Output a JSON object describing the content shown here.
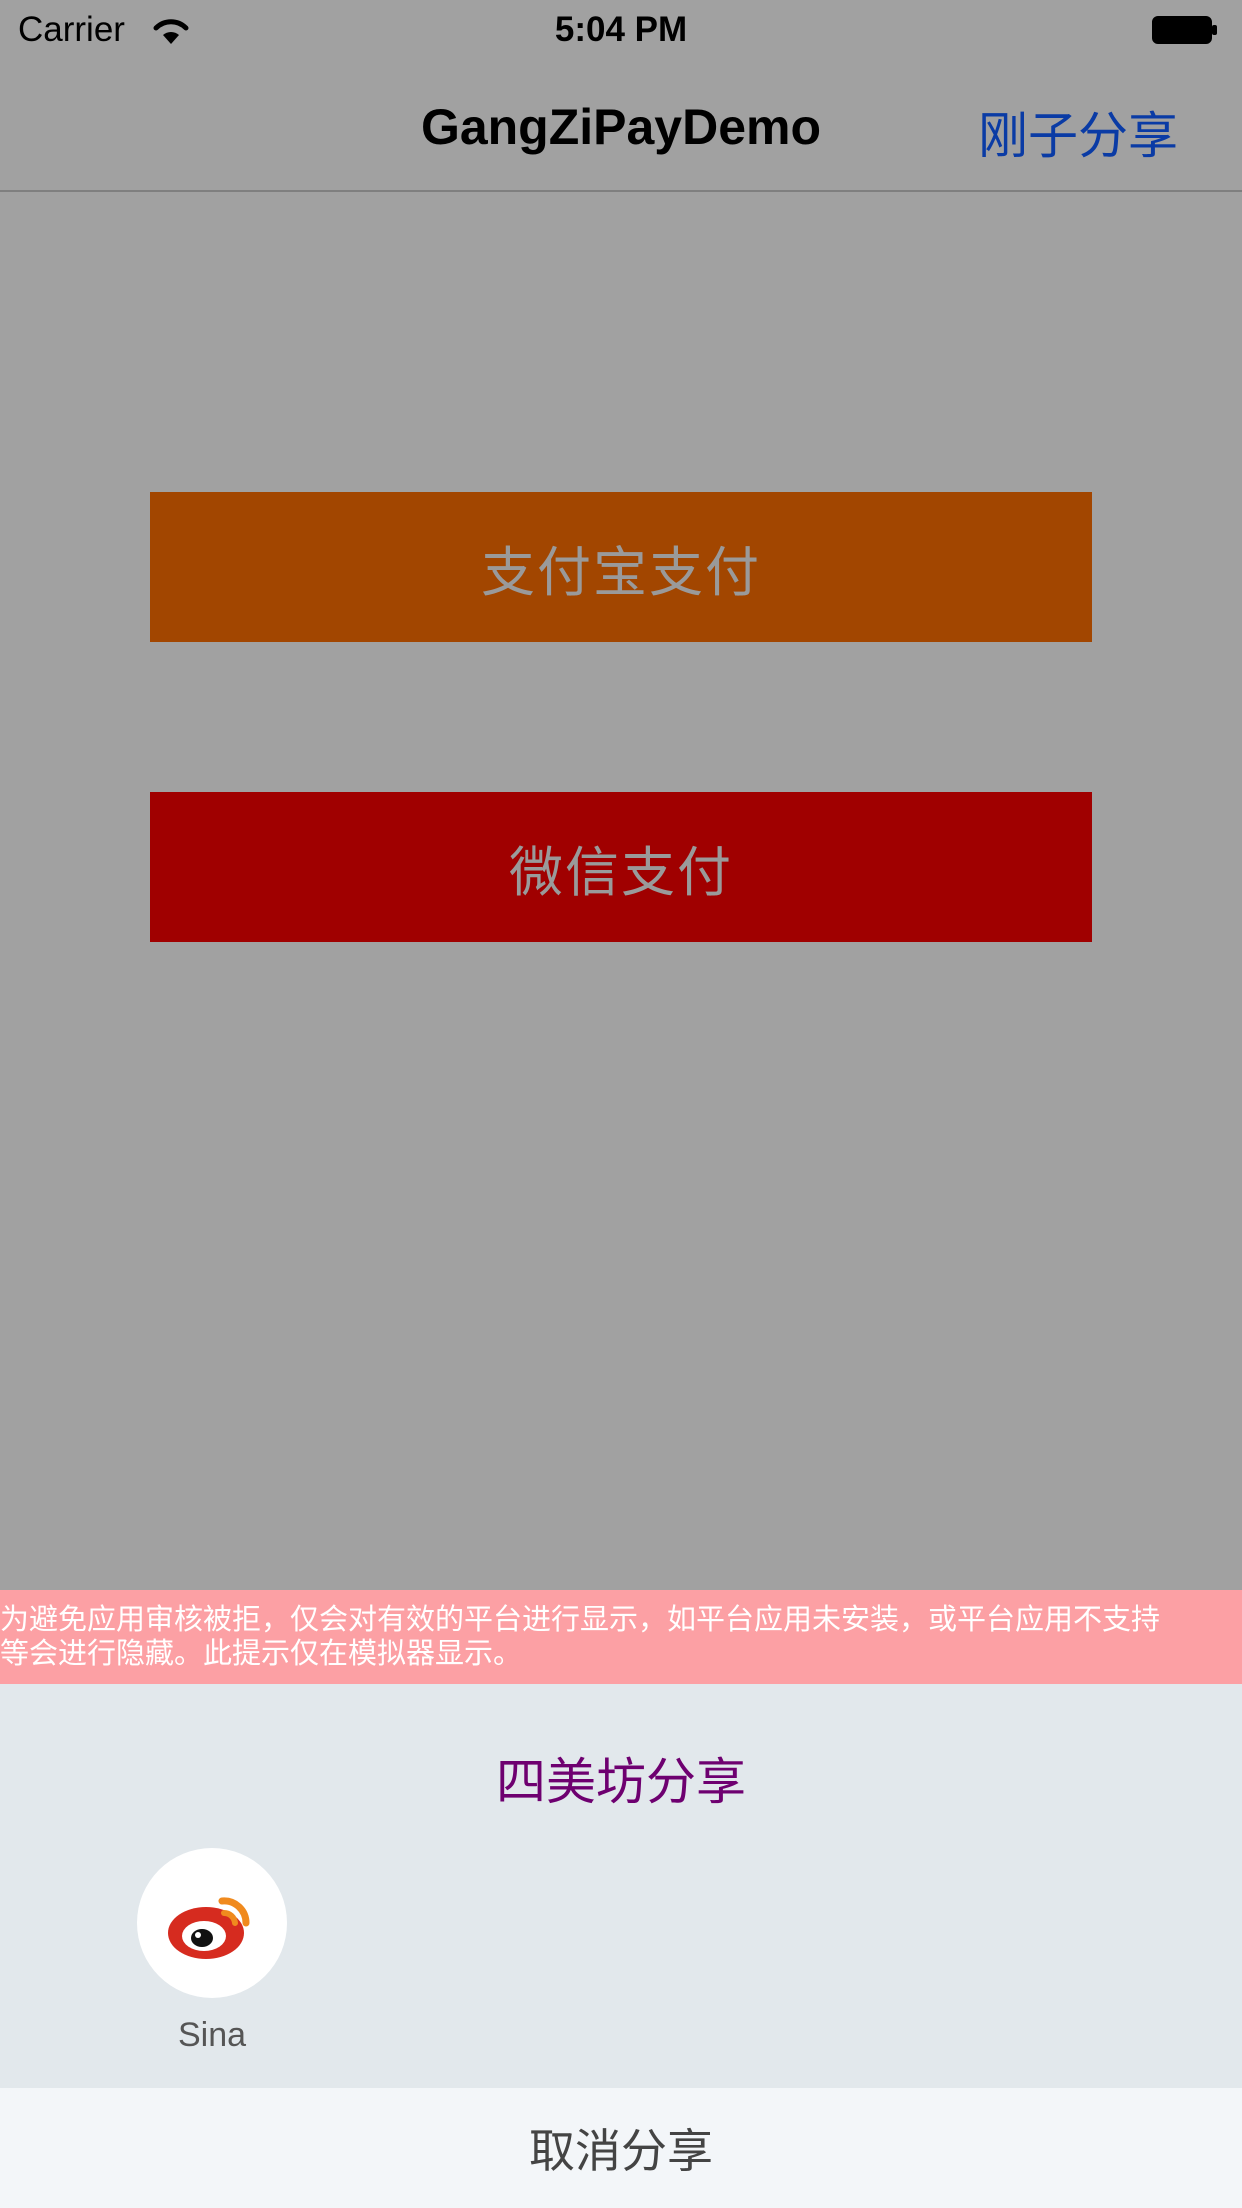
{
  "status_bar": {
    "carrier": "Carrier",
    "time": "5:04 PM",
    "wifi_icon": "wifi-icon",
    "battery_icon": "battery-icon"
  },
  "nav_bar": {
    "title": "GangZiPayDemo",
    "right_button": "刚子分享"
  },
  "main": {
    "alipay_button": "支付宝支付",
    "wechat_button": "微信支付"
  },
  "share_sheet": {
    "notice_line1": "为避免应用审核被拒，仅会对有效的平台进行显示，如平台应用未安装，或平台应用不支持",
    "notice_line2": "等会进行隐藏。此提示仅在模拟器显示。",
    "title": "四美坊分享",
    "platforms": [
      {
        "label": "Sina",
        "icon": "weibo-icon"
      }
    ],
    "cancel": "取消分享"
  },
  "colors": {
    "background": "#a1a1a1",
    "alipay": "#a24600",
    "wechat": "#a00000",
    "nav_accent": "#0a3ba5",
    "notice": "#fca0a4",
    "sheet_title": "#6e0070",
    "panel": "#e2e8ec",
    "cancel_bg": "#f3f6f9"
  }
}
